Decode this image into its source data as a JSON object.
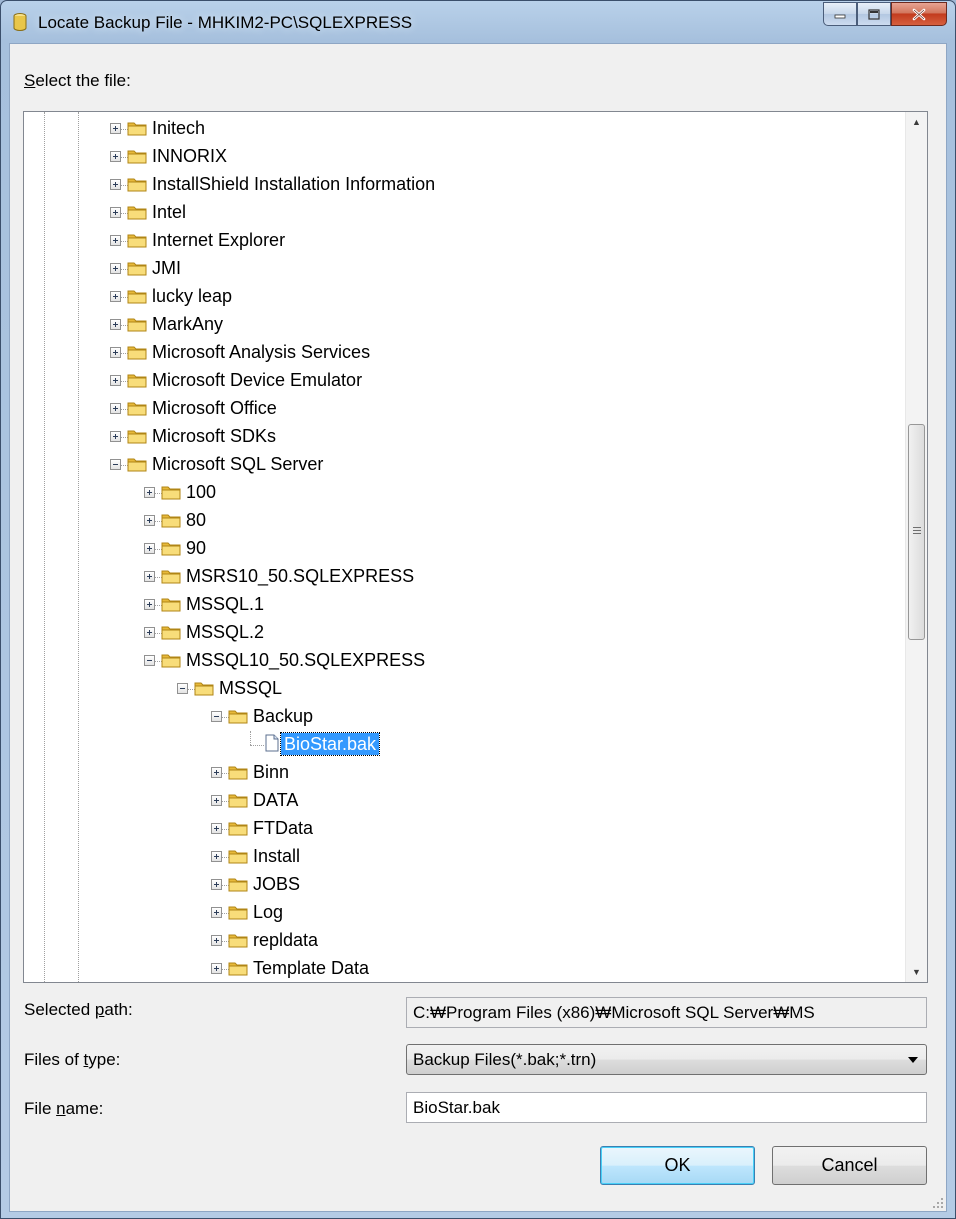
{
  "window": {
    "title": "Locate Backup File - MHKIM2-PC\\SQLEXPRESS",
    "icon": "database-icon"
  },
  "select_label": {
    "prefix": "S",
    "rest": "elect the file:"
  },
  "tree": {
    "nodes": [
      {
        "label": "Initech",
        "level": 0,
        "expander": "plus"
      },
      {
        "label": "INNORIX",
        "level": 0,
        "expander": "plus"
      },
      {
        "label": "InstallShield Installation Information",
        "level": 0,
        "expander": "plus"
      },
      {
        "label": "Intel",
        "level": 0,
        "expander": "plus"
      },
      {
        "label": "Internet Explorer",
        "level": 0,
        "expander": "plus"
      },
      {
        "label": "JMI",
        "level": 0,
        "expander": "plus"
      },
      {
        "label": "lucky leap",
        "level": 0,
        "expander": "plus"
      },
      {
        "label": "MarkAny",
        "level": 0,
        "expander": "plus"
      },
      {
        "label": "Microsoft Analysis Services",
        "level": 0,
        "expander": "plus"
      },
      {
        "label": "Microsoft Device Emulator",
        "level": 0,
        "expander": "plus"
      },
      {
        "label": "Microsoft Office",
        "level": 0,
        "expander": "plus"
      },
      {
        "label": "Microsoft SDKs",
        "level": 0,
        "expander": "plus"
      },
      {
        "label": "Microsoft SQL Server",
        "level": 0,
        "expander": "minus"
      },
      {
        "label": "100",
        "level": 1,
        "expander": "plus"
      },
      {
        "label": "80",
        "level": 1,
        "expander": "plus"
      },
      {
        "label": "90",
        "level": 1,
        "expander": "plus"
      },
      {
        "label": "MSRS10_50.SQLEXPRESS",
        "level": 1,
        "expander": "plus"
      },
      {
        "label": "MSSQL.1",
        "level": 1,
        "expander": "plus"
      },
      {
        "label": "MSSQL.2",
        "level": 1,
        "expander": "plus"
      },
      {
        "label": "MSSQL10_50.SQLEXPRESS",
        "level": 1,
        "expander": "minus"
      },
      {
        "label": "MSSQL",
        "level": 2,
        "expander": "minus"
      },
      {
        "label": "Backup",
        "level": 3,
        "expander": "minus"
      },
      {
        "label": "BioStar.bak",
        "level": 4,
        "expander": "none",
        "selected": true,
        "type": "file"
      },
      {
        "label": "Binn",
        "level": 3,
        "expander": "plus"
      },
      {
        "label": "DATA",
        "level": 3,
        "expander": "plus"
      },
      {
        "label": "FTData",
        "level": 3,
        "expander": "plus"
      },
      {
        "label": "Install",
        "level": 3,
        "expander": "plus"
      },
      {
        "label": "JOBS",
        "level": 3,
        "expander": "plus"
      },
      {
        "label": "Log",
        "level": 3,
        "expander": "plus"
      },
      {
        "label": "repldata",
        "level": 3,
        "expander": "plus"
      },
      {
        "label": "Template Data",
        "level": 3,
        "expander": "plus"
      }
    ]
  },
  "selected_path": {
    "label_prefix": "Selected ",
    "label_u": "p",
    "label_rest": "ath:",
    "value": "C:₩Program Files (x86)₩Microsoft SQL Server₩MS"
  },
  "files_of_type": {
    "label_prefix": "Files of ",
    "label_u": "t",
    "label_rest": "ype:",
    "value": "Backup Files(*.bak;*.trn)"
  },
  "file_name": {
    "label_prefix": "File ",
    "label_u": "n",
    "label_rest": "ame:",
    "value": "BioStar.bak"
  },
  "buttons": {
    "ok": "OK",
    "cancel": "Cancel"
  },
  "colors": {
    "selection": "#3399ff",
    "folder": "#f5d36a"
  }
}
